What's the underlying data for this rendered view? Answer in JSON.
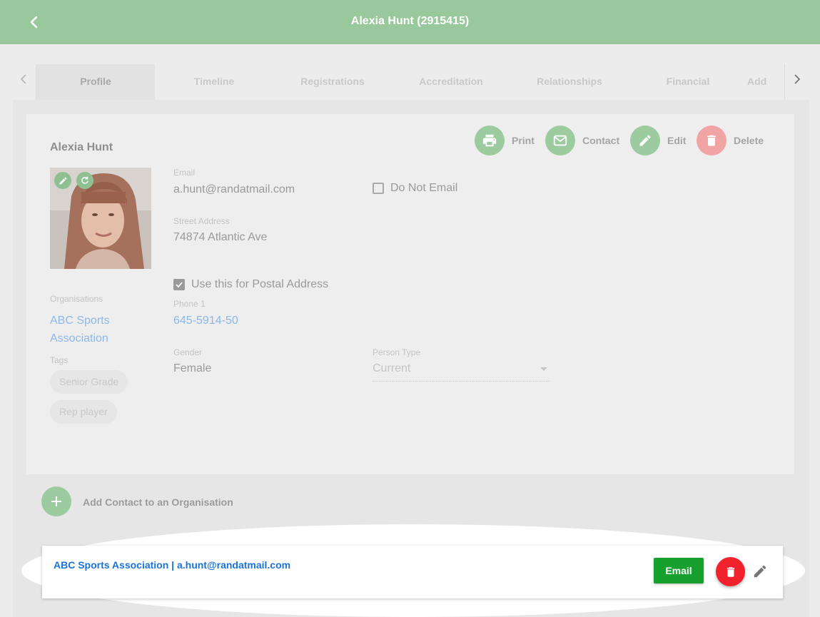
{
  "appbar": {
    "title": "Alexia Hunt (2915415)",
    "back_icon": "chevron-left-icon"
  },
  "tabs": [
    {
      "label": "Profile",
      "active": true
    },
    {
      "label": "Timeline"
    },
    {
      "label": "Registrations"
    },
    {
      "label": "Accreditation"
    },
    {
      "label": "Relationships"
    },
    {
      "label": "Financial"
    },
    {
      "label": "Add"
    }
  ],
  "profile": {
    "name": "Alexia Hunt",
    "actions": [
      {
        "label": "Print",
        "icon": "print-icon"
      },
      {
        "label": "Contact",
        "icon": "mail-icon"
      },
      {
        "label": "Edit",
        "icon": "pencil-icon"
      },
      {
        "label": "Delete",
        "icon": "trash-icon"
      }
    ],
    "email_label": "Email",
    "email": "a.hunt@randatmail.com",
    "do_not_email_label": "Do Not Email",
    "do_not_email": false,
    "street_label": "Street Address",
    "street": "74874 Atlantic Ave",
    "postal_label": "Use this for Postal Address",
    "postal_checked": true,
    "phone_label": "Phone 1",
    "phone": "645-5914-50",
    "gender_label": "Gender",
    "gender": "Female",
    "person_type_label": "Person Type",
    "person_type": "Current",
    "organisations_label": "Organisations",
    "organisation_line1": "ABC Sports",
    "organisation_line2": "Association",
    "tags_label": "Tags",
    "tags": [
      "Senior Grade",
      "Rep player"
    ]
  },
  "add_contact": {
    "label": "Add Contact to an Organisation"
  },
  "org_row": {
    "text": "ABC Sports Association | a.hunt@randatmail.com",
    "email_button": "Email"
  },
  "colors": {
    "appbar": "#9ac89d",
    "link": "#1a73d9",
    "email_button": "#16a12f",
    "delete_button": "#f2222c"
  }
}
